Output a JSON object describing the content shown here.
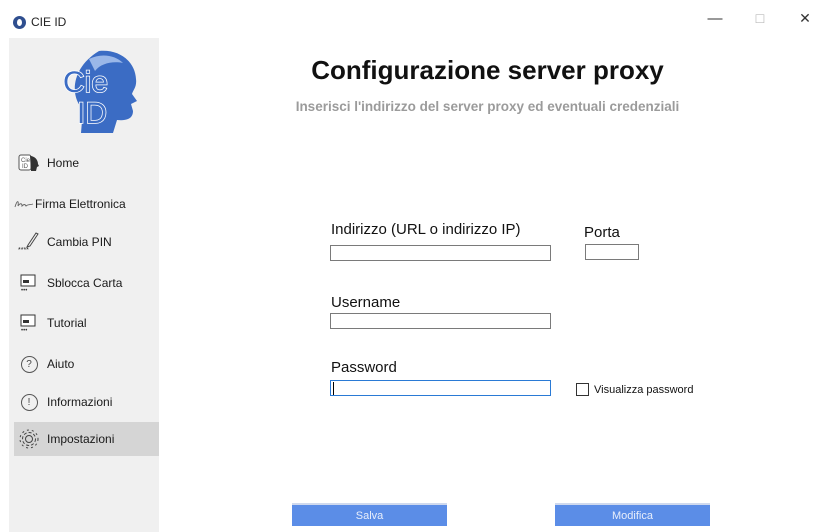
{
  "window": {
    "title": "CIE ID",
    "minimize": "—",
    "maximize": "☐",
    "close": "✕"
  },
  "sidebar": {
    "logo": {
      "line1": "Cie",
      "line2": "ID",
      "color": "#3b6cc4"
    },
    "items": [
      {
        "label": "Home",
        "icon": "cie-card-icon"
      },
      {
        "label": "Firma Elettronica",
        "icon": "signature-icon"
      },
      {
        "label": "Cambia PIN",
        "icon": "pen-pin-icon"
      },
      {
        "label": "Sblocca Carta",
        "icon": "card-reader-icon"
      },
      {
        "label": "Tutorial",
        "icon": "card-reader-icon"
      },
      {
        "label": "Aiuto",
        "icon": "question-circle-icon",
        "glyph": "?"
      },
      {
        "label": "Informazioni",
        "icon": "exclamation-circle-icon",
        "glyph": "!"
      },
      {
        "label": "Impostazioni",
        "icon": "gear-icon",
        "active": true
      }
    ]
  },
  "main": {
    "title": "Configurazione server proxy",
    "subtitle": "Inserisci l'indirizzo del server proxy ed eventuali credenziali",
    "address": {
      "label": "Indirizzo (URL o indirizzo IP)",
      "value": ""
    },
    "port": {
      "label": "Porta",
      "value": ""
    },
    "username": {
      "label": "Username",
      "value": ""
    },
    "password": {
      "label": "Password",
      "value": ""
    },
    "show_password": {
      "label": "Visualizza password",
      "checked": false
    },
    "save_button": "Salva",
    "edit_button": "Modifica"
  },
  "colors": {
    "button": "#5b8de7",
    "sidebar": "#f0f0f0",
    "active_item": "#d5d5d5",
    "subtitle": "#9b9b9b"
  }
}
